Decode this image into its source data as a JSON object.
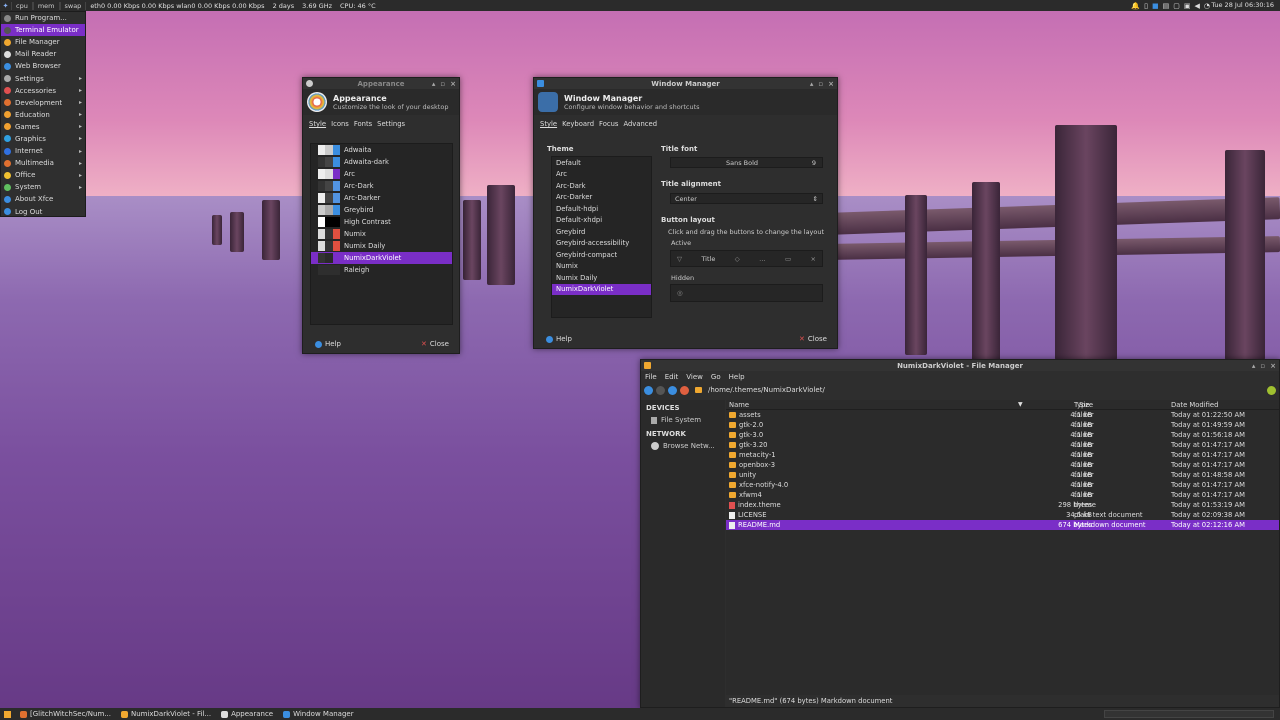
{
  "top_panel": {
    "graphs": [
      "cpu",
      "mem",
      "swap"
    ],
    "net": "eth0 0.00 Kbps 0.00 Kbps  wlan0 0.00 Kbps 0.00 Kbps",
    "uptime": "2 days",
    "cpu_freq": "3.69 GHz",
    "cpu_temp": "CPU: 46 °C",
    "clock": "Tue 28 Jul 06:30:16"
  },
  "app_menu": {
    "items": [
      {
        "label": "Run Program...",
        "icon_color": "#888",
        "submenu": false
      },
      {
        "label": "Terminal Emulator",
        "icon_color": "#555",
        "submenu": false,
        "selected": true
      },
      {
        "label": "File Manager",
        "icon_color": "#f0a830",
        "submenu": false
      },
      {
        "label": "Mail Reader",
        "icon_color": "#ddd",
        "submenu": false
      },
      {
        "label": "Web Browser",
        "icon_color": "#3b8ee0",
        "submenu": false
      },
      {
        "label": "Settings",
        "icon_color": "#aaa",
        "submenu": true
      },
      {
        "label": "Accessories",
        "icon_color": "#e05050",
        "submenu": true
      },
      {
        "label": "Development",
        "icon_color": "#e07030",
        "submenu": true
      },
      {
        "label": "Education",
        "icon_color": "#f0a030",
        "submenu": true
      },
      {
        "label": "Games",
        "icon_color": "#f0a030",
        "submenu": true
      },
      {
        "label": "Graphics",
        "icon_color": "#30a0e0",
        "submenu": true
      },
      {
        "label": "Internet",
        "icon_color": "#3070e0",
        "submenu": true
      },
      {
        "label": "Multimedia",
        "icon_color": "#e07030",
        "submenu": true
      },
      {
        "label": "Office",
        "icon_color": "#f0c030",
        "submenu": true
      },
      {
        "label": "System",
        "icon_color": "#60c060",
        "submenu": true
      },
      {
        "label": "About Xfce",
        "icon_color": "#3b8ee0",
        "submenu": false
      },
      {
        "label": "Log Out",
        "icon_color": "#3b8ee0",
        "submenu": false
      }
    ]
  },
  "appearance": {
    "window_title": "Appearance",
    "header_title": "Appearance",
    "header_sub": "Customize the look of your desktop",
    "tabs": [
      "Style",
      "Icons",
      "Fonts",
      "Settings"
    ],
    "themes": [
      {
        "name": "Adwaita",
        "colors": [
          "#eee",
          "#ccc",
          "#3b8ee0"
        ]
      },
      {
        "name": "Adwaita-dark",
        "colors": [
          "#333",
          "#444",
          "#3b8ee0"
        ]
      },
      {
        "name": "Arc",
        "colors": [
          "#eee",
          "#ddd",
          "#7a2ec7"
        ]
      },
      {
        "name": "Arc-Dark",
        "colors": [
          "#333",
          "#444",
          "#5294e2"
        ]
      },
      {
        "name": "Arc-Darker",
        "colors": [
          "#eee",
          "#444",
          "#5294e2"
        ]
      },
      {
        "name": "Greybird",
        "colors": [
          "#ccc",
          "#aaa",
          "#3b8ee0"
        ]
      },
      {
        "name": "High Contrast",
        "colors": [
          "#fff",
          "#000",
          "#000"
        ]
      },
      {
        "name": "Numix",
        "colors": [
          "#ddd",
          "#333",
          "#e05040"
        ]
      },
      {
        "name": "Numix Daily",
        "colors": [
          "#ddd",
          "#333",
          "#e05040"
        ]
      },
      {
        "name": "NumixDarkViolet",
        "colors": [
          "#333",
          "#2a2a2a",
          "#7a2ec7"
        ],
        "selected": true
      },
      {
        "name": "Raleigh",
        "colors": [
          "#2e2e2e",
          "#2e2e2e",
          "#2e2e2e"
        ]
      }
    ],
    "help": "Help",
    "close": "Close"
  },
  "wm": {
    "window_title": "Window Manager",
    "header_title": "Window Manager",
    "header_sub": "Configure window behavior and shortcuts",
    "tabs": [
      "Style",
      "Keyboard",
      "Focus",
      "Advanced"
    ],
    "theme_label": "Theme",
    "themes": [
      "Default",
      "Arc",
      "Arc-Dark",
      "Arc-Darker",
      "Default-hdpi",
      "Default-xhdpi",
      "Greybird",
      "Greybird-accessibility",
      "Greybird-compact",
      "Numix",
      "Numix Daily",
      "NumixDarkViolet"
    ],
    "selected_theme": "NumixDarkViolet",
    "title_font_label": "Title font",
    "title_font": "Sans Bold",
    "title_font_size": "9",
    "title_alignment_label": "Title alignment",
    "title_alignment": "Center",
    "button_layout_label": "Button layout",
    "button_layout_hint": "Click and drag the buttons to change the layout",
    "active_label": "Active",
    "active_title": "Title",
    "hidden_label": "Hidden",
    "help": "Help",
    "close": "Close"
  },
  "fm": {
    "window_title": "NumixDarkViolet - File Manager",
    "menu": [
      "File",
      "Edit",
      "View",
      "Go",
      "Help"
    ],
    "path": "/home/.themes/NumixDarkViolet/",
    "devices_label": "DEVICES",
    "file_system": "File System",
    "network_label": "NETWORK",
    "browse_network": "Browse Netw...",
    "columns": {
      "name": "Name",
      "size": "Size",
      "type": "Type",
      "date": "Date Modified"
    },
    "files": [
      {
        "name": "assets",
        "size": "4.1 kB",
        "type": "folder",
        "date": "Today at 01:22:50 AM",
        "kind": "folder"
      },
      {
        "name": "gtk-2.0",
        "size": "4.1 kB",
        "type": "folder",
        "date": "Today at 01:49:59 AM",
        "kind": "folder"
      },
      {
        "name": "gtk-3.0",
        "size": "4.1 kB",
        "type": "folder",
        "date": "Today at 01:56:18 AM",
        "kind": "folder"
      },
      {
        "name": "gtk-3.20",
        "size": "4.1 kB",
        "type": "folder",
        "date": "Today at 01:47:17 AM",
        "kind": "folder"
      },
      {
        "name": "metacity-1",
        "size": "4.1 kB",
        "type": "folder",
        "date": "Today at 01:47:17 AM",
        "kind": "folder"
      },
      {
        "name": "openbox-3",
        "size": "4.1 kB",
        "type": "folder",
        "date": "Today at 01:47:17 AM",
        "kind": "folder"
      },
      {
        "name": "unity",
        "size": "4.1 kB",
        "type": "folder",
        "date": "Today at 01:48:58 AM",
        "kind": "folder"
      },
      {
        "name": "xfce-notify-4.0",
        "size": "4.1 kB",
        "type": "folder",
        "date": "Today at 01:47:17 AM",
        "kind": "folder"
      },
      {
        "name": "xfwm4",
        "size": "4.1 kB",
        "type": "folder",
        "date": "Today at 01:47:17 AM",
        "kind": "folder"
      },
      {
        "name": "index.theme",
        "size": "298 bytes",
        "type": "theme",
        "date": "Today at 01:53:19 AM",
        "kind": "theme"
      },
      {
        "name": "LICENSE",
        "size": "34.5 kB",
        "type": "plain text document",
        "date": "Today at 02:09:38 AM",
        "kind": "text"
      },
      {
        "name": "README.md",
        "size": "674 bytes",
        "type": "Markdown document",
        "date": "Today at 02:12:16 AM",
        "kind": "text",
        "selected": true
      }
    ],
    "status": "\"README.md\" (674 bytes) Markdown document"
  },
  "taskbar": {
    "tasks": [
      {
        "label": "[GlitchWitchSec/Num...",
        "color": "#e07030"
      },
      {
        "label": "NumixDarkViolet - Fil...",
        "color": "#f0a830"
      },
      {
        "label": "Appearance",
        "color": "#ddd"
      },
      {
        "label": "Window Manager",
        "color": "#3b8ee0"
      }
    ]
  },
  "colors": {
    "accent": "#7a2ec7",
    "panel": "#2b2b2b",
    "window": "#2e2e2e"
  }
}
